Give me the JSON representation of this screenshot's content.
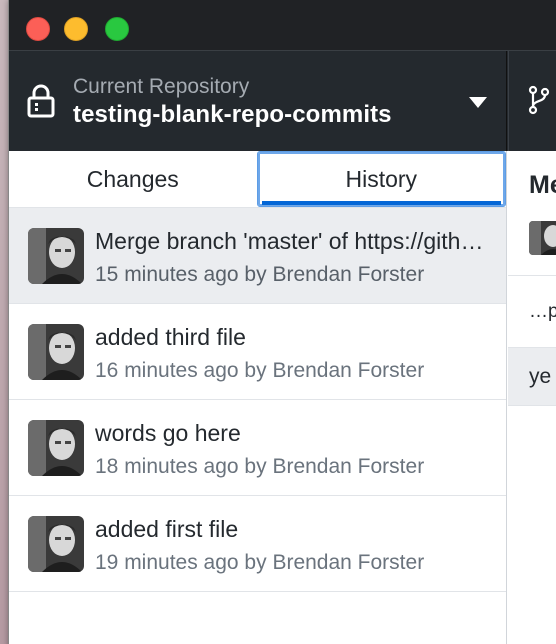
{
  "window": {
    "traffic_lights": {
      "close": "#fc5f57",
      "minimize": "#fdbc2e",
      "maximize": "#29c840"
    }
  },
  "toolbar": {
    "repository": {
      "description": "Current Repository",
      "name": "testing-blank-repo-commits",
      "lock_icon": "lock-icon",
      "dropdown_icon": "triangle-down-icon"
    },
    "branch": {
      "icon": "git-branch-icon"
    }
  },
  "sidebar": {
    "tabs": [
      {
        "label": "Changes",
        "selected": false
      },
      {
        "label": "History",
        "selected": true
      }
    ],
    "commits": [
      {
        "summary": "Merge branch 'master' of https://github.com/shiftkey/testing-blank-repo-commits",
        "meta": "15 minutes ago by Brendan Forster",
        "selected": true
      },
      {
        "summary": "added third file",
        "meta": "16 minutes ago by Brendan Forster",
        "selected": false
      },
      {
        "summary": "words go here",
        "meta": "18 minutes ago by Brendan Forster",
        "selected": false
      },
      {
        "summary": "added first file",
        "meta": "19 minutes ago by Brendan Forster",
        "selected": false
      }
    ]
  },
  "detail_pane": {
    "title_partial": "Me",
    "file_partial": "…p",
    "selected_partial": "ye"
  },
  "colors": {
    "toolbar_bg": "#24292e",
    "accent": "#0366d6",
    "selected_row": "#ebedf0",
    "meta_text": "#6a737d"
  }
}
